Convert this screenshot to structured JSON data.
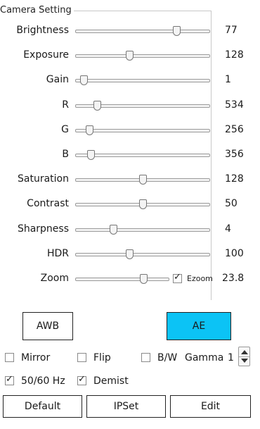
{
  "group_title": "Camera Setting",
  "sliders": [
    {
      "key": "brightness",
      "label": "Brightness",
      "value": "77",
      "level": 0.75
    },
    {
      "key": "exposure",
      "label": "Exposure",
      "value": "128",
      "level": 0.4
    },
    {
      "key": "gain",
      "label": "Gain",
      "value": "1",
      "level": 0.06
    },
    {
      "key": "r",
      "label": "R",
      "value": "534",
      "level": 0.16
    },
    {
      "key": "g",
      "label": "G",
      "value": "256",
      "level": 0.1
    },
    {
      "key": "b",
      "label": "B",
      "value": "356",
      "level": 0.11
    },
    {
      "key": "saturation",
      "label": "Saturation",
      "value": "128",
      "level": 0.5
    },
    {
      "key": "contrast",
      "label": "Contrast",
      "value": "50",
      "level": 0.5
    },
    {
      "key": "sharpness",
      "label": "Sharpness",
      "value": "4",
      "level": 0.28
    },
    {
      "key": "hdr",
      "label": "HDR",
      "value": "100",
      "level": 0.4
    }
  ],
  "zoom": {
    "label": "Zoom",
    "value": "23.8",
    "level": 0.73,
    "ezoom_label": "Ezoom",
    "ezoom_checked": true
  },
  "buttons": {
    "awb": "AWB",
    "ae": "AE",
    "default": "Default",
    "ipset": "IPSet",
    "edit": "Edit"
  },
  "options": {
    "mirror": {
      "label": "Mirror",
      "checked": false
    },
    "flip": {
      "label": "Flip",
      "checked": false
    },
    "bw": {
      "label": "B/W",
      "checked": false
    },
    "gamma": {
      "label": "Gamma",
      "value": "1"
    },
    "hz": {
      "label": "50/60 Hz",
      "checked": true
    },
    "demist": {
      "label": "Demist",
      "checked": true
    }
  },
  "colors": {
    "ae_active": "#0cc3f5"
  }
}
